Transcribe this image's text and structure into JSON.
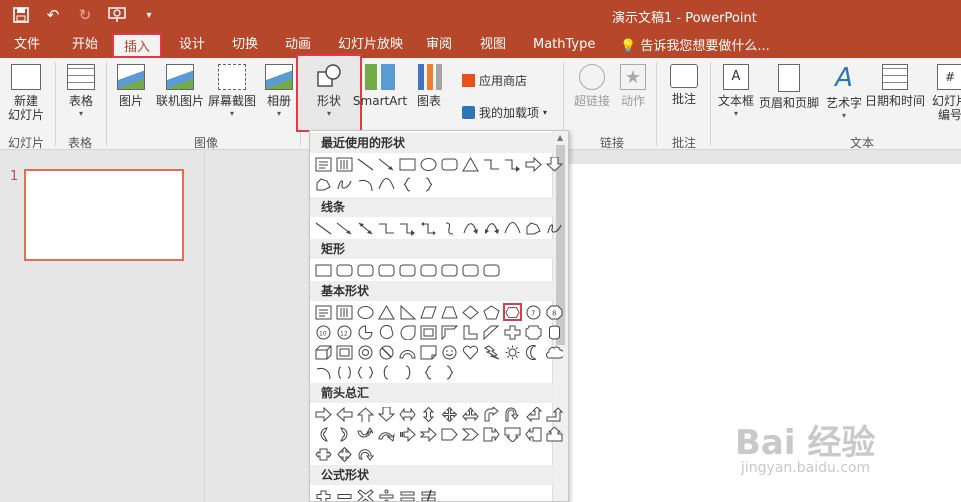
{
  "window": {
    "title": "演示文稿1 - PowerPoint"
  },
  "quick_access": {
    "icons": [
      "save-icon",
      "undo-icon",
      "redo-icon",
      "present-icon",
      "customize-icon"
    ]
  },
  "tabs": [
    "文件",
    "开始",
    "插入",
    "设计",
    "切换",
    "动画",
    "幻灯片放映",
    "审阅",
    "视图",
    "MathType"
  ],
  "active_tab": "插入",
  "tell_me": "告诉我您想要做什么...",
  "ribbon": {
    "new_slide": "新建\n幻灯片",
    "new_slide_l1": "新建",
    "new_slide_l2": "幻灯片",
    "table": "表格",
    "picture": "图片",
    "online_picture": "联机图片",
    "screenshot": "屏幕截图",
    "album": "相册",
    "shapes": "形状",
    "smartart": "SmartArt",
    "chart": "图表",
    "store": "应用商店",
    "my_addins": "我的加载项",
    "hyperlink": "超链接",
    "action": "动作",
    "comment": "批注",
    "textbox": "文本框",
    "header_footer": "页眉和页脚",
    "wordart": "艺术字",
    "datetime": "日期和时间",
    "slide_number_l1": "幻灯片",
    "slide_number_l2": "编号",
    "groups": {
      "slides": "幻灯片",
      "tables": "表格",
      "images": "图像",
      "links": "链接",
      "comments": "批注",
      "text": "文本"
    }
  },
  "slide_panel": {
    "slide_number": "1"
  },
  "shapes_menu": {
    "sections": [
      "最近使用的形状",
      "线条",
      "矩形",
      "基本形状",
      "箭头总汇",
      "公式形状"
    ]
  },
  "watermark": {
    "brand": "Bai 经验",
    "url": "jingyan.baidu.com"
  },
  "colors": {
    "accent": "#b7472a",
    "highlight": "#e03a4a"
  }
}
